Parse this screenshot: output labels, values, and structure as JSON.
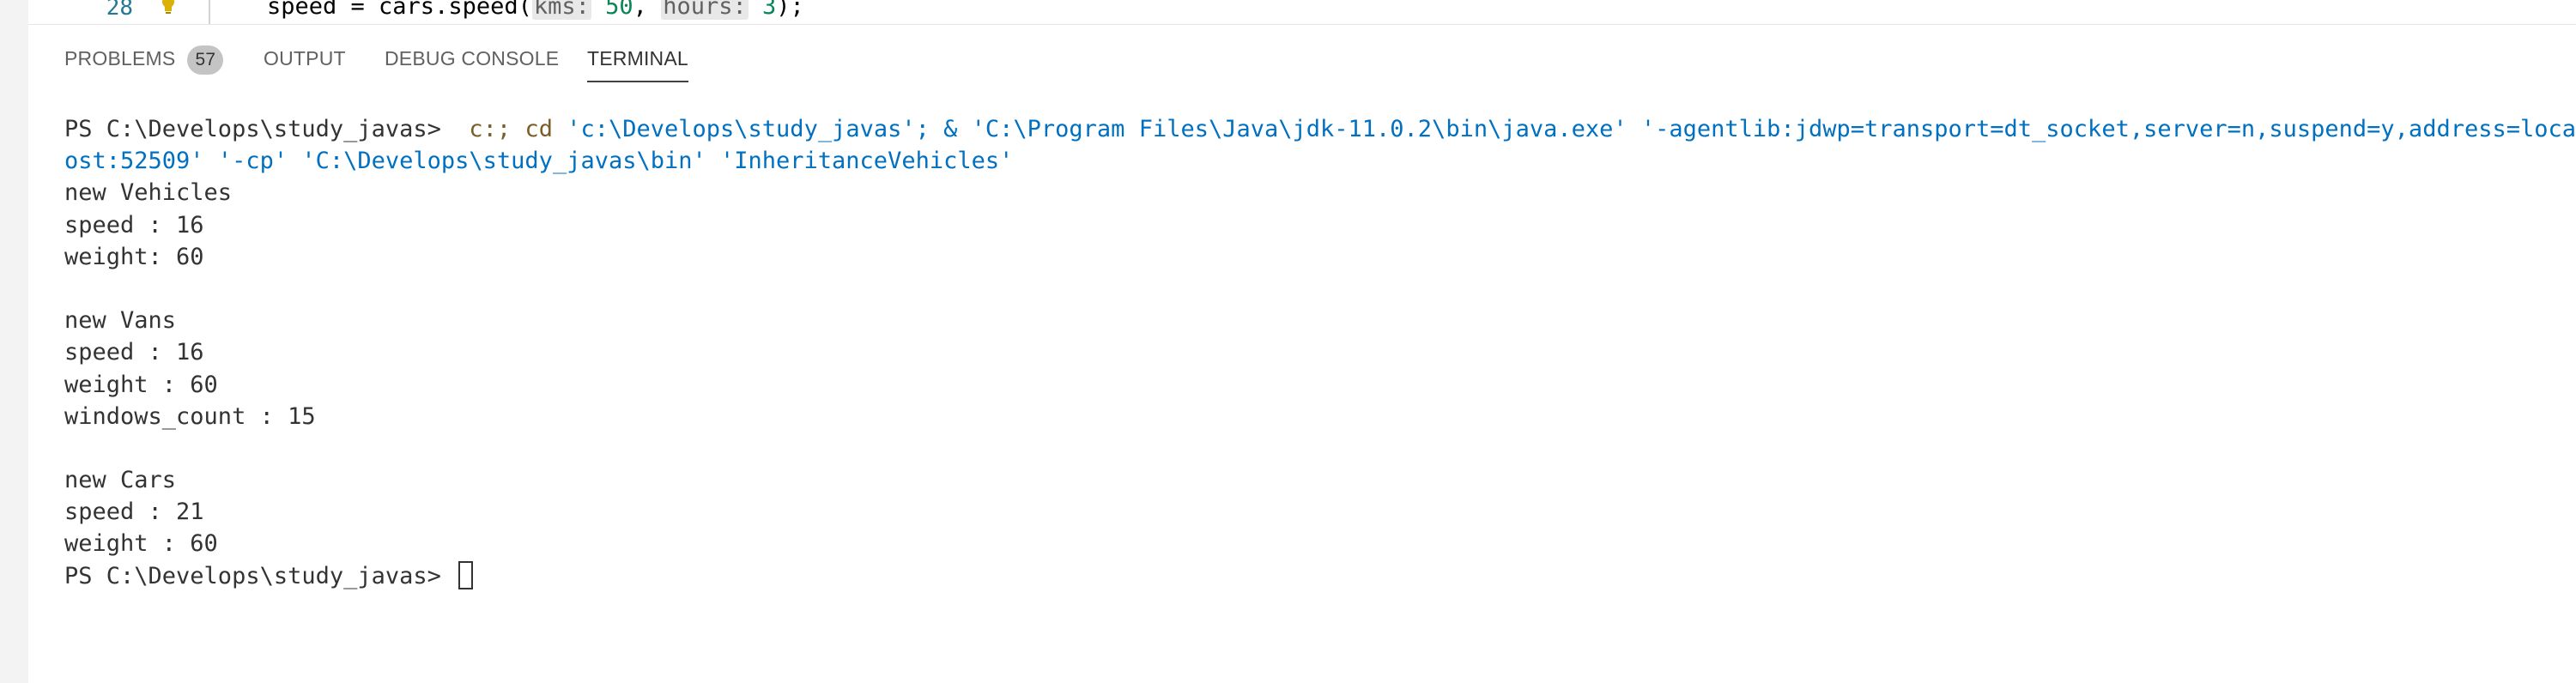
{
  "editor": {
    "line_number": "28",
    "code_prefix": "speed = cars.speed(",
    "param1_hint": "kms:",
    "param1_value": "50",
    "separator": ", ",
    "param2_hint": "hours:",
    "param2_value": "3",
    "code_suffix": ");"
  },
  "panel": {
    "tabs": [
      {
        "label": "PROBLEMS",
        "badge": "57"
      },
      {
        "label": "OUTPUT"
      },
      {
        "label": "DEBUG CONSOLE"
      },
      {
        "label": "TERMINAL",
        "active": true
      }
    ]
  },
  "terminal": {
    "prompt": "PS C:\\Develops\\study_javas> ",
    "cmd_drive": " c:;",
    "cmd_cd": " cd",
    "cmd_part1": " 'c:\\Develops\\study_javas'; & 'C:\\Program Files\\Java\\jdk-11.0.2\\bin\\java.exe' '-agentlib:jdwp=transport=dt_socket,server=n,suspend=y,address=localh",
    "cmd_part2": "ost:52509' '-cp' 'C:\\Develops\\study_javas\\bin' 'InheritanceVehicles'",
    "output_lines": [
      "new Vehicles",
      "speed : 16",
      "weight: 60",
      "",
      "new Vans",
      "speed : 16",
      "weight : 60",
      "windows_count : 15",
      "",
      "new Cars",
      "speed : 21",
      "weight : 60"
    ],
    "final_prompt": "PS C:\\Develops\\study_javas> "
  },
  "colors": {
    "accent_string": "#0070c1",
    "accent_keyword": "#795e26",
    "line_number": "#237893"
  }
}
